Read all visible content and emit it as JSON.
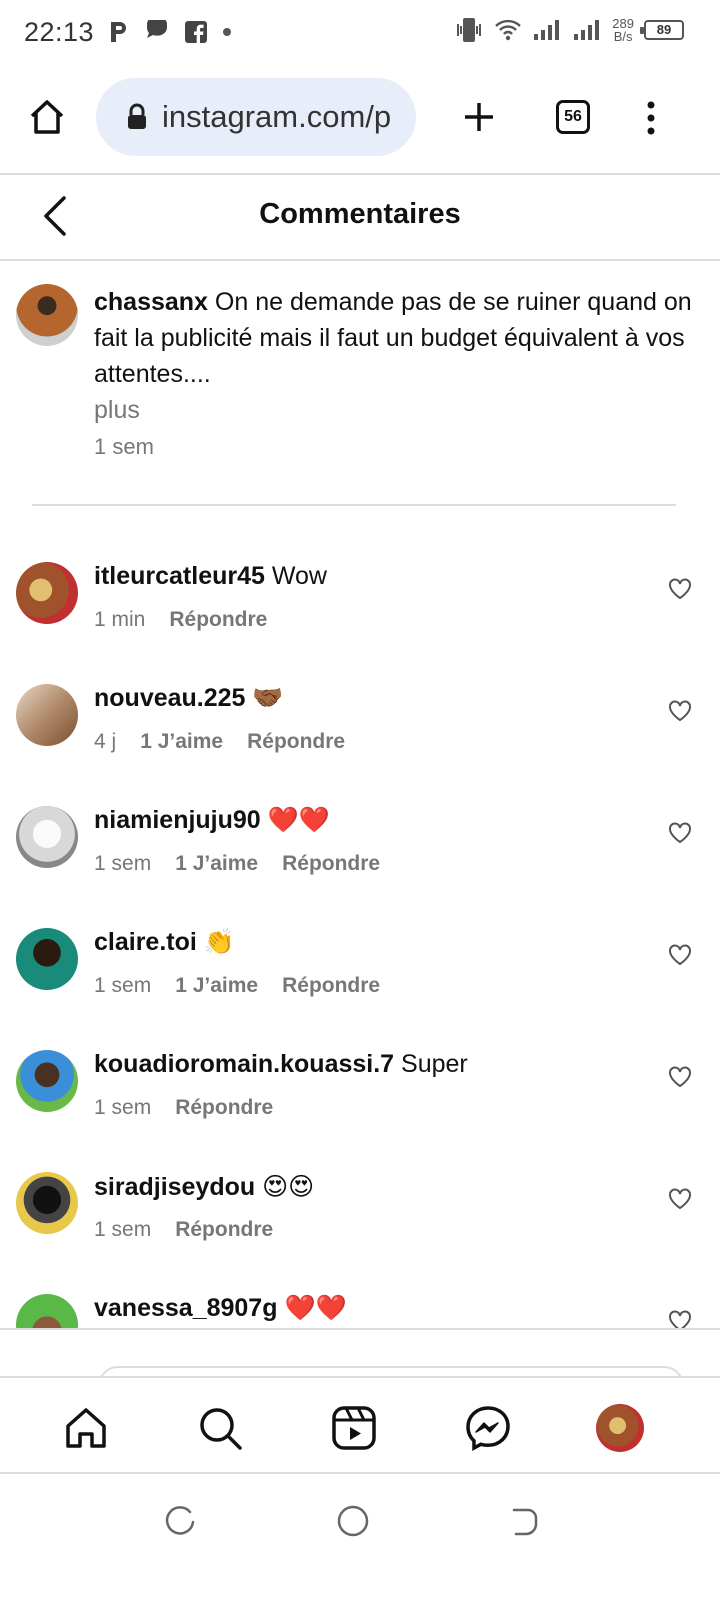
{
  "status_bar": {
    "time": "22:13",
    "net_speed_value": "289",
    "net_speed_unit": "B/s",
    "battery": "89"
  },
  "browser": {
    "url": "instagram.com/p",
    "tab_count": "56"
  },
  "header": {
    "title": "Commentaires"
  },
  "caption": {
    "username": "chassanx",
    "text": "On ne demande pas de se ruiner quand on fait la publicité mais il faut un budget équivalent à vos attentes....",
    "more_label": "plus",
    "time": "1 sem"
  },
  "comments": [
    {
      "username": "itleurcatleur45",
      "text": "Wow",
      "time": "1 min",
      "likes": "",
      "reply": "Répondre",
      "avatar_color": "#a0522d"
    },
    {
      "username": "nouveau.225",
      "text": "🤝🏾",
      "time": "4 j",
      "likes": "1 J’aime",
      "reply": "Répondre",
      "avatar_color": "#b08a6a"
    },
    {
      "username": "niamienjuju90",
      "text": "❤️❤️",
      "time": "1 sem",
      "likes": "1 J’aime",
      "reply": "Répondre",
      "avatar_color": "#d8d8d8"
    },
    {
      "username": "claire.toi",
      "text": "👏",
      "time": "1 sem",
      "likes": "1 J’aime",
      "reply": "Répondre",
      "avatar_color": "#1a8a7a"
    },
    {
      "username": "kouadioromain.kouassi.7",
      "text": "Super",
      "time": "1 sem",
      "likes": "",
      "reply": "Répondre",
      "avatar_color": "#3a8fd8"
    },
    {
      "username": "siradjiseydou",
      "text": "😍😍",
      "time": "1 sem",
      "likes": "",
      "reply": "Répondre",
      "avatar_color": "#e8c84a"
    },
    {
      "username": "vanessa_8907g",
      "text": "❤️❤️",
      "time": "",
      "likes": "",
      "reply": "",
      "avatar_color": "#5ab848"
    }
  ],
  "bottom_nav": [
    "home-icon",
    "search-icon",
    "reels-icon",
    "messenger-icon",
    "profile-avatar"
  ],
  "colors": {
    "url_pill": "#e8eef9",
    "muted_text": "#777777",
    "divider": "#dddddd"
  }
}
